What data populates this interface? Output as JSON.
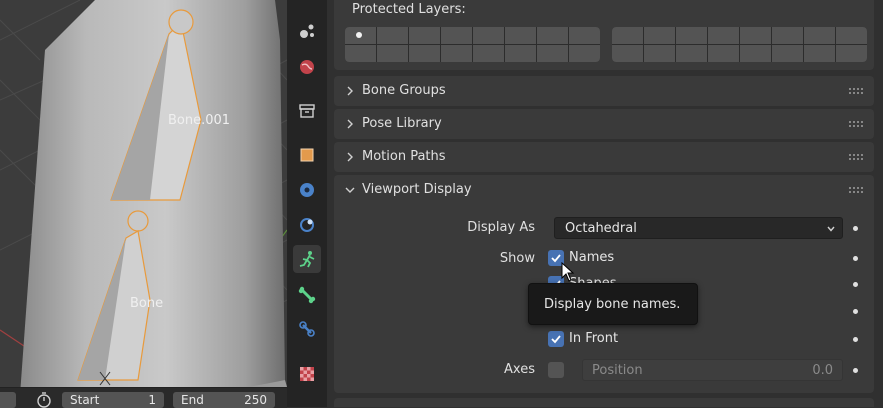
{
  "viewport": {
    "bone_labels": [
      "Bone.001",
      "Bone"
    ]
  },
  "timeline": {
    "start_label": "Start",
    "start_value": "1",
    "end_label": "End",
    "end_value": "250"
  },
  "properties_tabs": [
    {
      "icon": "particles-icon"
    },
    {
      "icon": "world-icon"
    },
    {
      "icon": "collection-icon"
    },
    {
      "icon": "object-icon"
    },
    {
      "icon": "modifiers-icon"
    },
    {
      "icon": "physics-icon"
    },
    {
      "icon": "armature-data-icon",
      "active": true
    },
    {
      "icon": "bone-icon"
    },
    {
      "icon": "bone-constraints-icon"
    },
    {
      "icon": "texture-icon"
    }
  ],
  "protected_layers": {
    "label": "Protected Layers:"
  },
  "panels": {
    "bone_groups": "Bone Groups",
    "pose_library": "Pose Library",
    "motion_paths": "Motion Paths",
    "viewport_display": "Viewport Display"
  },
  "viewport_display": {
    "display_as_label": "Display As",
    "display_as_value": "Octahedral",
    "show_label": "Show",
    "names_label": "Names",
    "names_checked": true,
    "shapes_label": "Shapes",
    "in_front_label": "In Front",
    "in_front_checked": true,
    "axes_label": "Axes",
    "axes_checked": false,
    "axes_position_label": "Position",
    "axes_position_value": "0.0"
  },
  "tooltip": {
    "text": "Display bone names."
  },
  "colors": {
    "checkbox_on": "#4772b3",
    "bone_outline": "#e89a3c",
    "active_tab_icon": "#5dd28a"
  }
}
